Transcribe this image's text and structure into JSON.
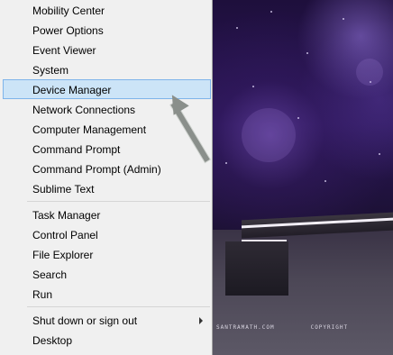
{
  "menu": {
    "group1": [
      {
        "label": "Mobility Center"
      },
      {
        "label": "Power Options"
      },
      {
        "label": "Event Viewer"
      },
      {
        "label": "System"
      },
      {
        "label": "Device Manager",
        "selected": true
      },
      {
        "label": "Network Connections"
      },
      {
        "label": "Computer Management"
      },
      {
        "label": "Command Prompt"
      },
      {
        "label": "Command Prompt (Admin)"
      },
      {
        "label": "Sublime Text"
      }
    ],
    "group2": [
      {
        "label": "Task Manager"
      },
      {
        "label": "Control Panel"
      },
      {
        "label": "File Explorer"
      },
      {
        "label": "Search"
      },
      {
        "label": "Run"
      }
    ],
    "group3": [
      {
        "label": "Shut down or sign out",
        "has_submenu": true
      },
      {
        "label": "Desktop"
      }
    ]
  },
  "colors": {
    "menu_bg": "#f0f0f0",
    "selected_bg": "#cce4f7",
    "selected_border": "#7eb4ea",
    "arrow": "#8a8f8b"
  },
  "wallpaper_watermark": {
    "left": "SANTRAMATH.COM",
    "right": "COPYRIGHT"
  }
}
